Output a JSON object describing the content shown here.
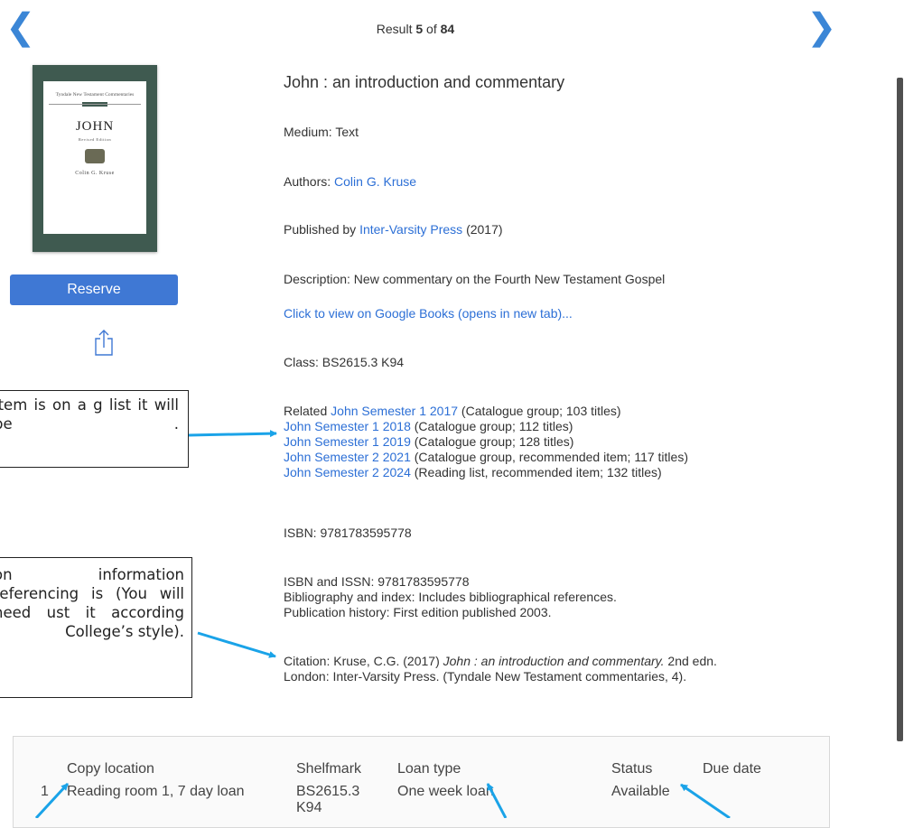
{
  "nav": {
    "prev_glyph": "❮",
    "next_glyph": "❯",
    "result_prefix": "Result",
    "result_index": "5",
    "result_of": "of",
    "result_total": "84"
  },
  "cover": {
    "series": "Tyndale New Testament Commentaries",
    "title": "JOHN",
    "edition": "Revised Edition",
    "author": "Colin G. Kruse",
    "band": "4"
  },
  "actions": {
    "reserve_label": "Reserve"
  },
  "callouts": {
    "reading_list": "item is on a g list it will be .",
    "citation": "on information referencing is (You will need ust it according College’s style)."
  },
  "record": {
    "title": "John : an introduction and commentary",
    "medium": "Medium: Text",
    "authors_label": "Authors:",
    "author": "Colin G. Kruse",
    "published_label": "Published by",
    "publisher": "Inter-Varsity Press",
    "published_year": "(2017)",
    "description": "Description: New commentary on the Fourth New Testament Gospel",
    "google_books": "Click to view on Google Books (opens in new tab)...",
    "class": "Class: BS2615.3 K94",
    "related_label": "Related",
    "related": [
      {
        "link": "John Semester 1 2017",
        "note": "(Catalogue group; 103 titles)"
      },
      {
        "link": "John Semester 1 2018",
        "note": "(Catalogue group; 112 titles)"
      },
      {
        "link": "John Semester 1 2019",
        "note": "(Catalogue group; 128 titles)"
      },
      {
        "link": "John Semester 2 2021",
        "note": "(Catalogue group, recommended item; 117 titles)"
      },
      {
        "link": "John Semester 2 2024",
        "note": "(Reading list, recommended item; 132 titles)"
      }
    ],
    "isbn": "ISBN: 9781783595778",
    "isbn_issn": "ISBN and ISSN: 9781783595778",
    "bibliography": "Bibliography and index: Includes bibliographical references.",
    "publication_history": "Publication history: First edition published 2003.",
    "citation_prefix": "Citation: Kruse, C.G. (2017)",
    "citation_title": "John : an introduction and commentary.",
    "citation_suffix": "2nd edn.",
    "citation_line2": "London: Inter-Varsity Press. (Tyndale New Testament commentaries, 4)."
  },
  "holdings": {
    "headers": {
      "copy_location": "Copy location",
      "shelfmark": "Shelfmark",
      "loan_type": "Loan type",
      "status": "Status",
      "due_date": "Due date"
    },
    "rows": [
      {
        "num": "1",
        "copy_location": "Reading room 1, 7 day loan",
        "shelfmark_line1": "BS2615.3",
        "shelfmark_line2": "K94",
        "loan_type": "One week loan",
        "status": "Available",
        "due_date": ""
      }
    ]
  },
  "colors": {
    "link": "#2c6fd6",
    "accent": "#3f78d4",
    "arrow": "#1aa3e8"
  }
}
